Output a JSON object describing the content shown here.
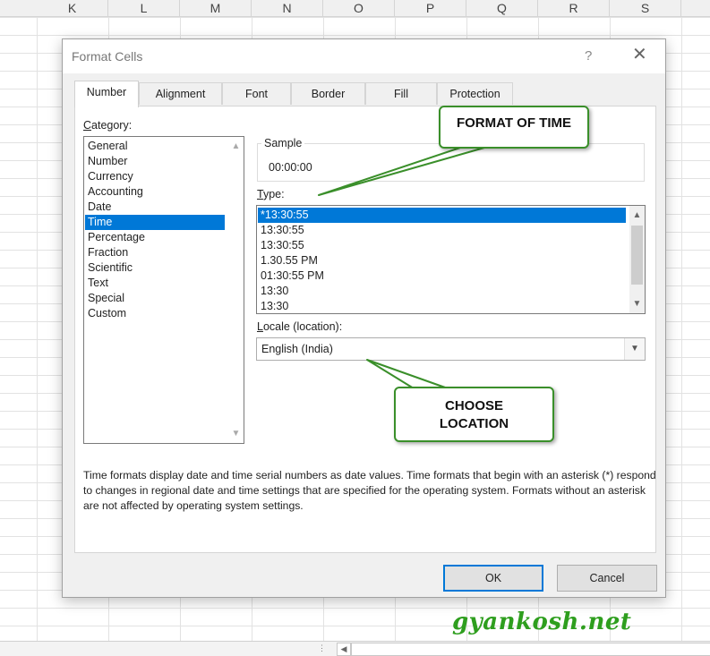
{
  "spreadsheet": {
    "columns": [
      "K",
      "L",
      "M",
      "N",
      "O",
      "P",
      "Q",
      "R",
      "S"
    ]
  },
  "dialog": {
    "title": "Format Cells",
    "help_glyph": "?",
    "close_glyph": "✕",
    "tabs": [
      "Number",
      "Alignment",
      "Font",
      "Border",
      "Fill",
      "Protection"
    ],
    "active_tab": "Number",
    "category": {
      "label_pre": "",
      "label_u": "C",
      "label_post": "ategory:",
      "items": [
        "General",
        "Number",
        "Currency",
        "Accounting",
        "Date",
        "Time",
        "Percentage",
        "Fraction",
        "Scientific",
        "Text",
        "Special",
        "Custom"
      ],
      "selected": "Time"
    },
    "sample": {
      "label": "Sample",
      "value": "00:00:00"
    },
    "type": {
      "label_u": "T",
      "label_post": "ype:",
      "items": [
        "*13:30:55",
        "13:30:55",
        "13:30:55",
        "1.30.55 PM",
        "01:30:55 PM",
        "13:30",
        "13:30"
      ],
      "selected": "*13:30:55"
    },
    "locale": {
      "label_u": "L",
      "label_post": "ocale (location):",
      "value": "English (India)"
    },
    "description": "Time formats display date and time serial numbers as date values.  Time formats that begin with an asterisk (*) respond to changes in regional date and time settings that are specified for the operating system. Formats without an asterisk are not affected by operating system settings.",
    "ok_label": "OK",
    "cancel_label": "Cancel"
  },
  "callouts": {
    "format_of_time": "FORMAT OF  TIME",
    "choose_location_line1": "CHOOSE",
    "choose_location_line2": "LOCATION"
  },
  "watermark": "gyankosh.net",
  "colors": {
    "selection": "#0078d7",
    "callout_border": "#3a8f2a",
    "watermark": "#2e9e1e"
  }
}
